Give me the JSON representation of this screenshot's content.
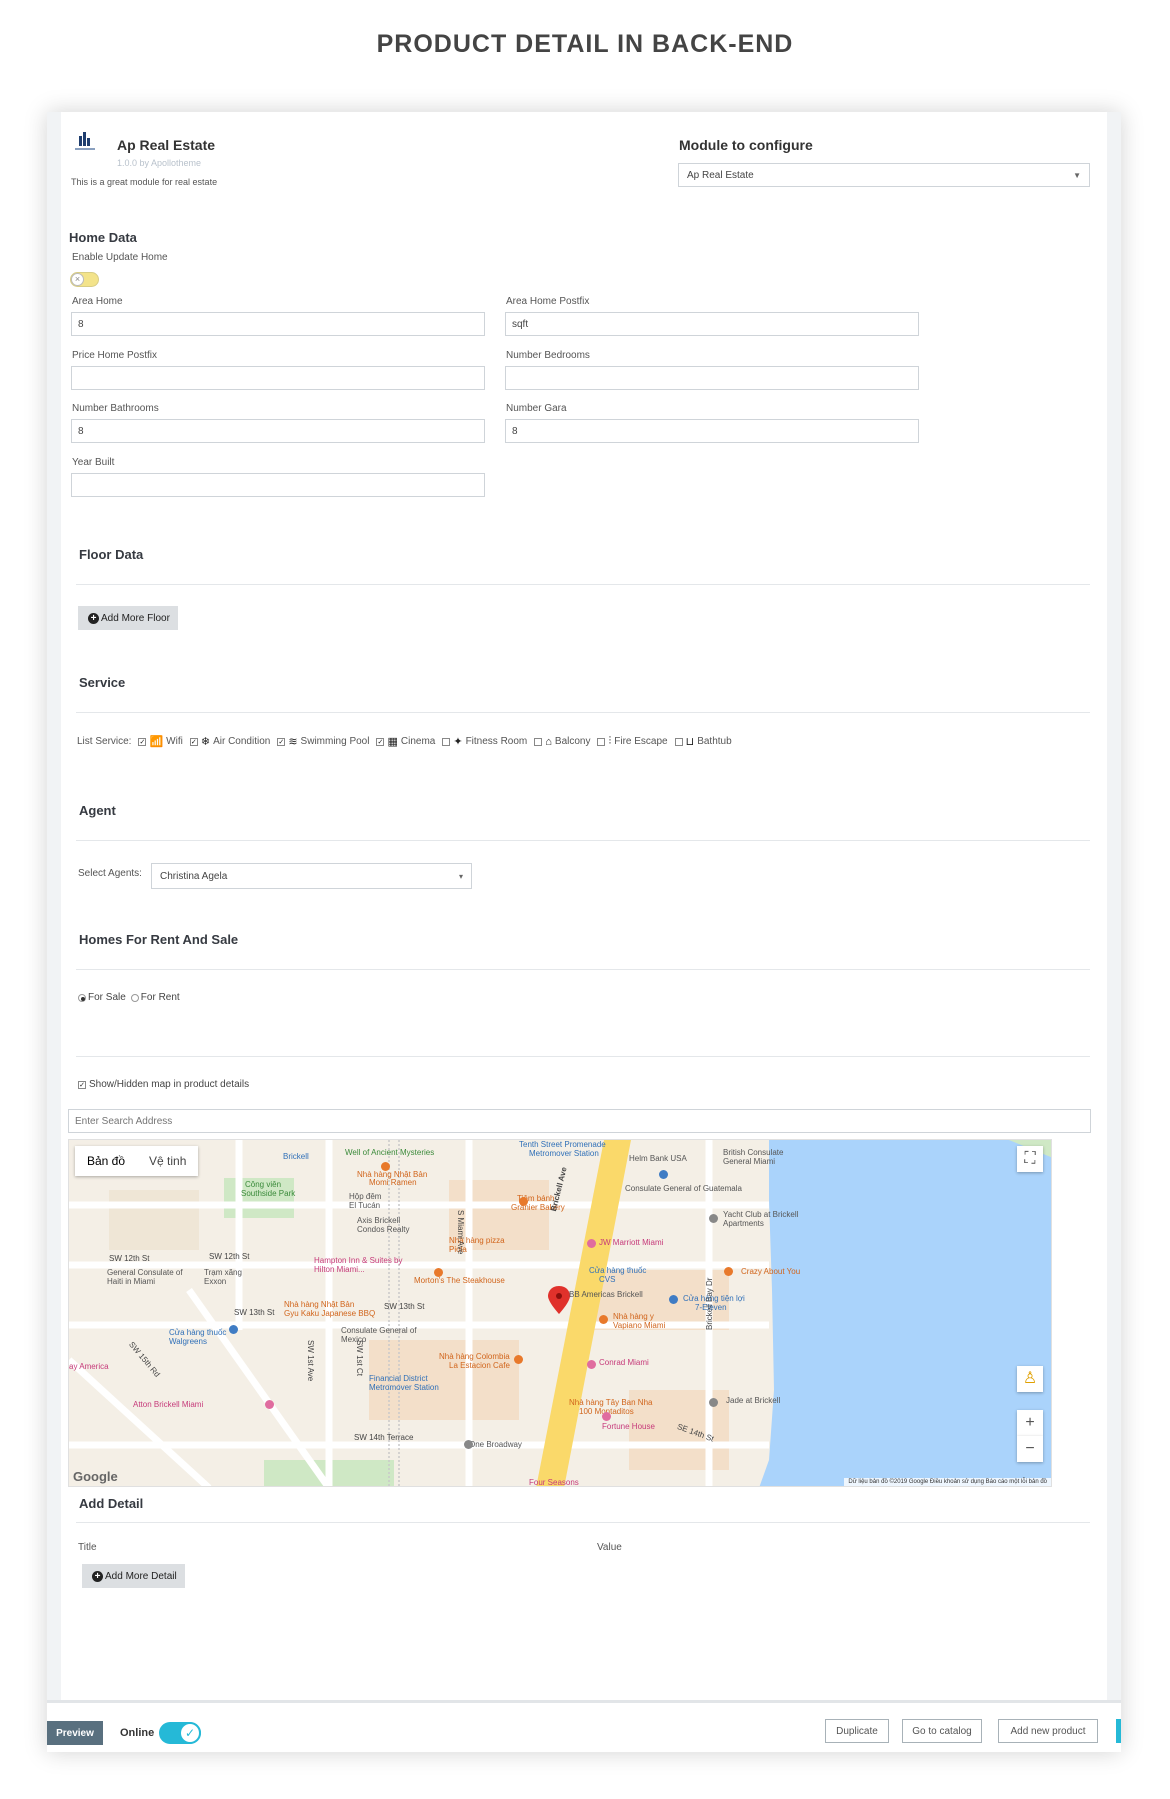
{
  "page_heading": "PRODUCT DETAIL IN BACK-END",
  "module": {
    "name": "Ap Real Estate",
    "version": "1.0.0 by Apollotheme",
    "description": "This is a great module for real estate",
    "configure_title": "Module to configure",
    "configure_value": "Ap Real Estate"
  },
  "home_data": {
    "title": "Home Data",
    "enable_update_label": "Enable Update Home",
    "area_home_label": "Area Home",
    "area_home_value": "8",
    "area_postfix_label": "Area Home Postfix",
    "area_postfix_value": "sqft",
    "price_postfix_label": "Price Home Postfix",
    "price_postfix_value": "",
    "bedrooms_label": "Number Bedrooms",
    "bedrooms_value": "",
    "bathrooms_label": "Number Bathrooms",
    "bathrooms_value": "8",
    "gara_label": "Number Gara",
    "gara_value": "8",
    "year_built_label": "Year Built",
    "year_built_value": ""
  },
  "floor_data": {
    "title": "Floor Data",
    "add_button": "Add More Floor"
  },
  "service": {
    "title": "Service",
    "list_label": "List Service:",
    "items": [
      {
        "label": "Wifi",
        "checked": true,
        "icon": "wifi-icon",
        "glyph": "📶"
      },
      {
        "label": "Air Condition",
        "checked": true,
        "icon": "air-condition-icon",
        "glyph": "❄"
      },
      {
        "label": "Swimming Pool",
        "checked": true,
        "icon": "swimming-pool-icon",
        "glyph": "≋"
      },
      {
        "label": "Cinema",
        "checked": true,
        "icon": "cinema-icon",
        "glyph": "▦"
      },
      {
        "label": "Fitness Room",
        "checked": false,
        "icon": "fitness-icon",
        "glyph": "✦"
      },
      {
        "label": "Balcony",
        "checked": false,
        "icon": "balcony-icon",
        "glyph": "⌂"
      },
      {
        "label": "Fire Escape",
        "checked": false,
        "icon": "fire-escape-icon",
        "glyph": "⫶"
      },
      {
        "label": "Bathtub",
        "checked": false,
        "icon": "bathtub-icon",
        "glyph": "⊔"
      }
    ]
  },
  "agent": {
    "title": "Agent",
    "select_label": "Select Agents:",
    "selected": "Christina Agela"
  },
  "rent_sale": {
    "title": "Homes For Rent And Sale",
    "options": [
      {
        "label": "For Sale",
        "selected": true
      },
      {
        "label": "For Rent",
        "selected": false
      }
    ]
  },
  "map_section": {
    "show_map_label": "Show/Hidden map in product details",
    "show_map_checked": true,
    "search_placeholder": "Enter Search Address",
    "tabs": [
      "Bản đồ",
      "Vệ tinh"
    ],
    "google": "Google",
    "attribution": "Dữ liệu bản đồ ©2019 Google   Điều khoản sử dụng   Báo cáo một lỗi bản đồ",
    "labels": [
      "Brickell",
      "Well of Ancient Mysteries",
      "Nhà hàng Nhật Bản",
      "Momi Ramen",
      "Tenth Street Promenade",
      "Metromover Station",
      "Helm Bank USA",
      "British Consulate General Miami",
      "Công viên",
      "Southside Park",
      "Hộp đêm",
      "El Tucán",
      "Consulate General of Guatemala",
      "Tiệm bánh",
      "Granier Bakery",
      "Yacht Club at Brickell Apartments",
      "Axis Brickell Condos Realty",
      "Nhà hàng pizza",
      "Piola",
      "JW Marriott Miami",
      "SW 12th St",
      "SW 12th St",
      "General Consulate of Haiti in Miami",
      "Trạm xăng",
      "Exxon",
      "Hampton Inn & Suites by Hilton Miami...",
      "Morton's The Steakhouse",
      "Cửa hàng thuốc",
      "CVS",
      "Crazy About You",
      "BB Americas Brickell",
      "SW 13th St",
      "SW 13th St",
      "Nhà hàng Nhật Bản",
      "Gyu Kaku Japanese BBQ",
      "Cửa hàng tiện lợi",
      "7-Eleven",
      "Nhà hàng y",
      "Vapiano Miami",
      "Cửa hàng thuốc",
      "Walgreens",
      "Consulate General of Mexico",
      "Nhà hàng Colombia",
      "La Estacion Cafe",
      "Conrad Miami",
      "Financial District Metromover Station",
      "Atton Brickell Miami",
      "Nhà hàng Tây Ban Nha",
      "100 Montaditos",
      "Jade at Brickell",
      "Fortune House",
      "One Broadway",
      "Four Seasons",
      "SW 14th Terrace",
      "Brickell Ave",
      "S Miami Ave",
      "SW 15th Rd",
      "SE 14th St",
      "Brickell Bay Dr",
      "ay America",
      "SW 1st Ct",
      "SW 1st Ave"
    ]
  },
  "add_detail": {
    "title": "Add Detail",
    "col_title": "Title",
    "col_value": "Value",
    "add_button": "Add More Detail"
  },
  "footer": {
    "preview": "Preview",
    "online": "Online",
    "duplicate": "Duplicate",
    "go_to_catalog": "Go to catalog",
    "add_new_product": "Add new product"
  }
}
